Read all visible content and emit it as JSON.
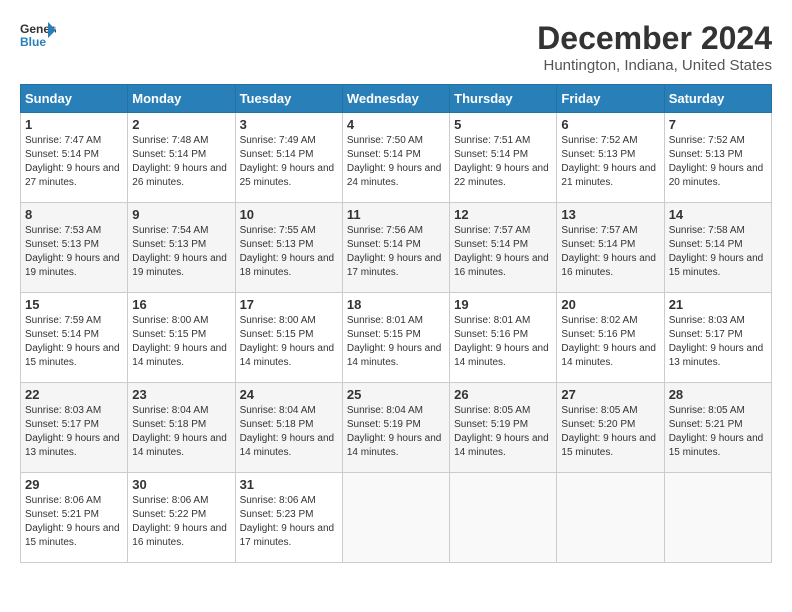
{
  "logo": {
    "line1": "General",
    "line2": "Blue"
  },
  "title": "December 2024",
  "subtitle": "Huntington, Indiana, United States",
  "days_of_week": [
    "Sunday",
    "Monday",
    "Tuesday",
    "Wednesday",
    "Thursday",
    "Friday",
    "Saturday"
  ],
  "weeks": [
    [
      {
        "day": "1",
        "sunrise": "7:47 AM",
        "sunset": "5:14 PM",
        "daylight": "9 hours and 27 minutes."
      },
      {
        "day": "2",
        "sunrise": "7:48 AM",
        "sunset": "5:14 PM",
        "daylight": "9 hours and 26 minutes."
      },
      {
        "day": "3",
        "sunrise": "7:49 AM",
        "sunset": "5:14 PM",
        "daylight": "9 hours and 25 minutes."
      },
      {
        "day": "4",
        "sunrise": "7:50 AM",
        "sunset": "5:14 PM",
        "daylight": "9 hours and 24 minutes."
      },
      {
        "day": "5",
        "sunrise": "7:51 AM",
        "sunset": "5:14 PM",
        "daylight": "9 hours and 22 minutes."
      },
      {
        "day": "6",
        "sunrise": "7:52 AM",
        "sunset": "5:13 PM",
        "daylight": "9 hours and 21 minutes."
      },
      {
        "day": "7",
        "sunrise": "7:52 AM",
        "sunset": "5:13 PM",
        "daylight": "9 hours and 20 minutes."
      }
    ],
    [
      {
        "day": "8",
        "sunrise": "7:53 AM",
        "sunset": "5:13 PM",
        "daylight": "9 hours and 19 minutes."
      },
      {
        "day": "9",
        "sunrise": "7:54 AM",
        "sunset": "5:13 PM",
        "daylight": "9 hours and 19 minutes."
      },
      {
        "day": "10",
        "sunrise": "7:55 AM",
        "sunset": "5:13 PM",
        "daylight": "9 hours and 18 minutes."
      },
      {
        "day": "11",
        "sunrise": "7:56 AM",
        "sunset": "5:14 PM",
        "daylight": "9 hours and 17 minutes."
      },
      {
        "day": "12",
        "sunrise": "7:57 AM",
        "sunset": "5:14 PM",
        "daylight": "9 hours and 16 minutes."
      },
      {
        "day": "13",
        "sunrise": "7:57 AM",
        "sunset": "5:14 PM",
        "daylight": "9 hours and 16 minutes."
      },
      {
        "day": "14",
        "sunrise": "7:58 AM",
        "sunset": "5:14 PM",
        "daylight": "9 hours and 15 minutes."
      }
    ],
    [
      {
        "day": "15",
        "sunrise": "7:59 AM",
        "sunset": "5:14 PM",
        "daylight": "9 hours and 15 minutes."
      },
      {
        "day": "16",
        "sunrise": "8:00 AM",
        "sunset": "5:15 PM",
        "daylight": "9 hours and 14 minutes."
      },
      {
        "day": "17",
        "sunrise": "8:00 AM",
        "sunset": "5:15 PM",
        "daylight": "9 hours and 14 minutes."
      },
      {
        "day": "18",
        "sunrise": "8:01 AM",
        "sunset": "5:15 PM",
        "daylight": "9 hours and 14 minutes."
      },
      {
        "day": "19",
        "sunrise": "8:01 AM",
        "sunset": "5:16 PM",
        "daylight": "9 hours and 14 minutes."
      },
      {
        "day": "20",
        "sunrise": "8:02 AM",
        "sunset": "5:16 PM",
        "daylight": "9 hours and 14 minutes."
      },
      {
        "day": "21",
        "sunrise": "8:03 AM",
        "sunset": "5:17 PM",
        "daylight": "9 hours and 13 minutes."
      }
    ],
    [
      {
        "day": "22",
        "sunrise": "8:03 AM",
        "sunset": "5:17 PM",
        "daylight": "9 hours and 13 minutes."
      },
      {
        "day": "23",
        "sunrise": "8:04 AM",
        "sunset": "5:18 PM",
        "daylight": "9 hours and 14 minutes."
      },
      {
        "day": "24",
        "sunrise": "8:04 AM",
        "sunset": "5:18 PM",
        "daylight": "9 hours and 14 minutes."
      },
      {
        "day": "25",
        "sunrise": "8:04 AM",
        "sunset": "5:19 PM",
        "daylight": "9 hours and 14 minutes."
      },
      {
        "day": "26",
        "sunrise": "8:05 AM",
        "sunset": "5:19 PM",
        "daylight": "9 hours and 14 minutes."
      },
      {
        "day": "27",
        "sunrise": "8:05 AM",
        "sunset": "5:20 PM",
        "daylight": "9 hours and 15 minutes."
      },
      {
        "day": "28",
        "sunrise": "8:05 AM",
        "sunset": "5:21 PM",
        "daylight": "9 hours and 15 minutes."
      }
    ],
    [
      {
        "day": "29",
        "sunrise": "8:06 AM",
        "sunset": "5:21 PM",
        "daylight": "9 hours and 15 minutes."
      },
      {
        "day": "30",
        "sunrise": "8:06 AM",
        "sunset": "5:22 PM",
        "daylight": "9 hours and 16 minutes."
      },
      {
        "day": "31",
        "sunrise": "8:06 AM",
        "sunset": "5:23 PM",
        "daylight": "9 hours and 17 minutes."
      },
      null,
      null,
      null,
      null
    ]
  ]
}
